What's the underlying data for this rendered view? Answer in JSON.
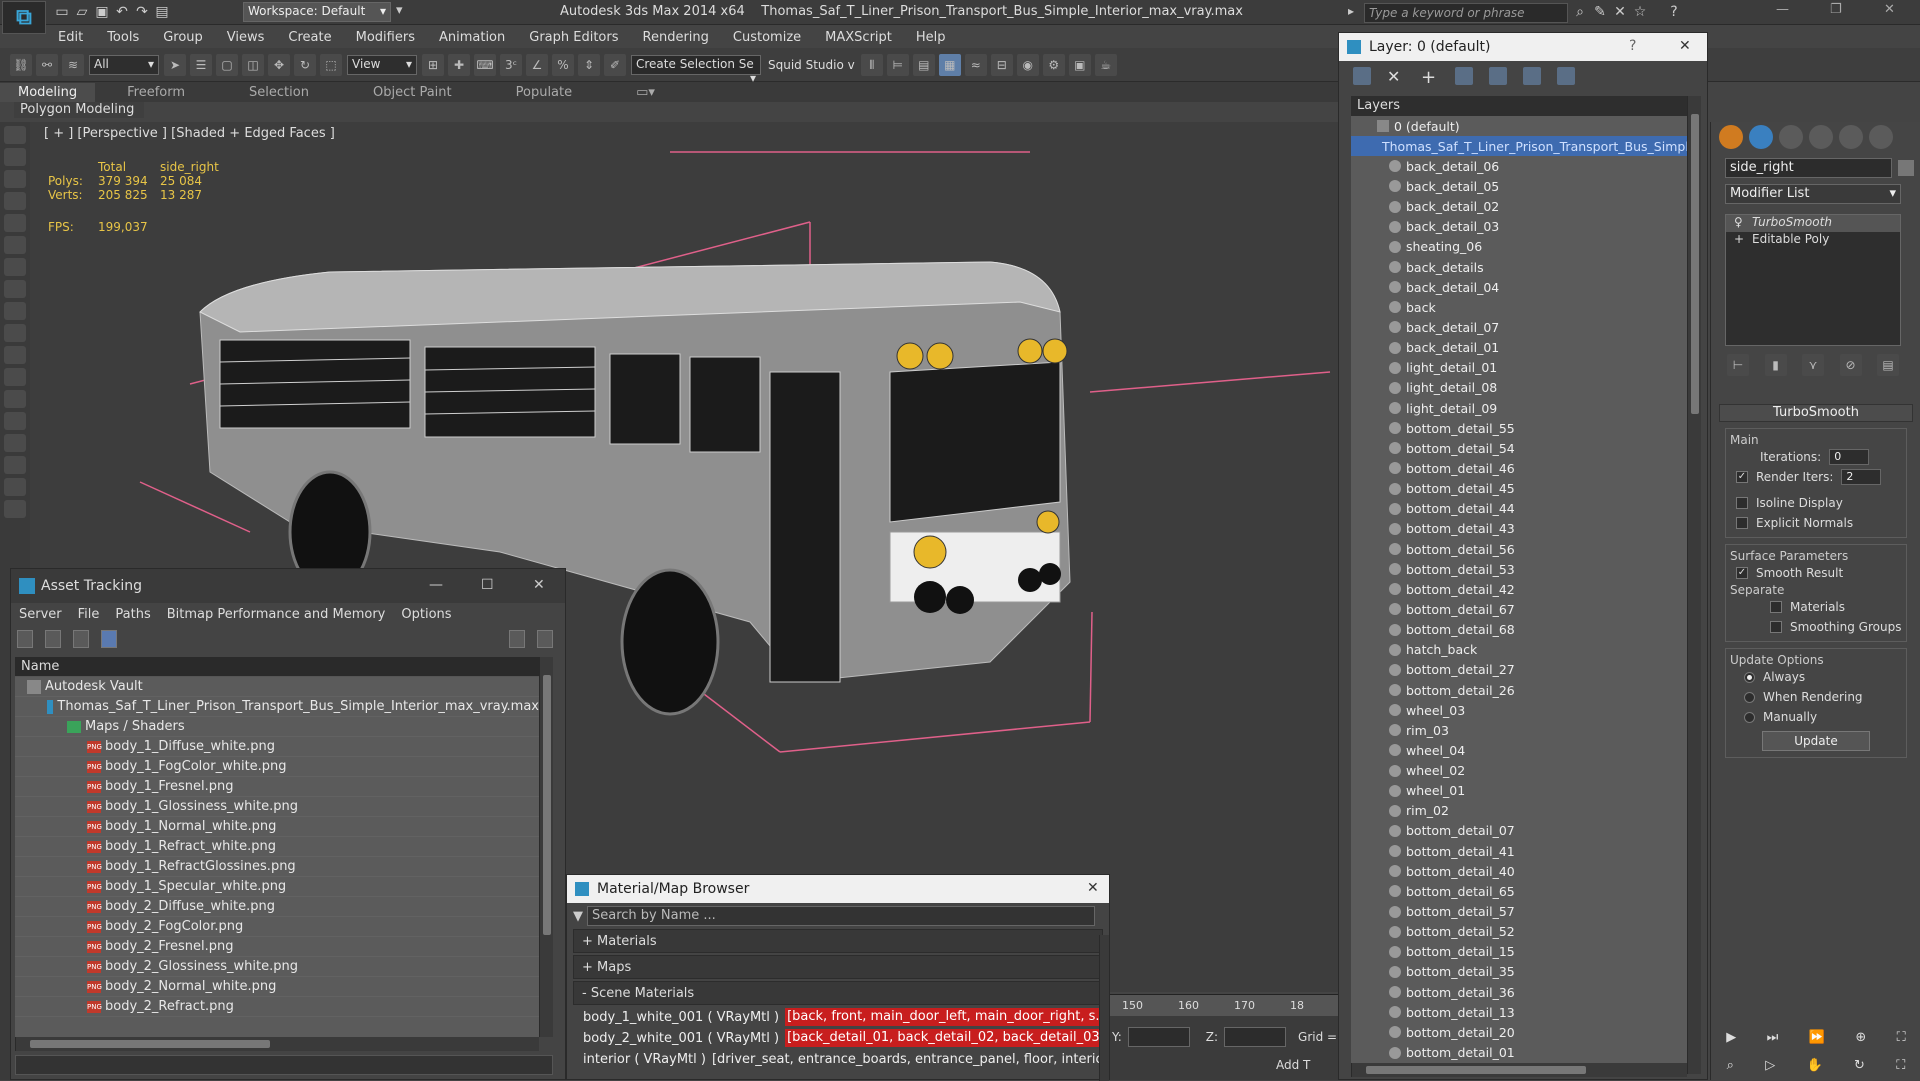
{
  "window": {
    "app_name": "Autodesk 3ds Max  2014 x64",
    "file_name": "Thomas_Saf_T_Liner_Prison_Transport_Bus_Simple_Interior_max_vray.max",
    "workspace": "Workspace: Default",
    "search_placeholder": "Type a keyword or phrase"
  },
  "menu": [
    "Edit",
    "Tools",
    "Group",
    "Views",
    "Create",
    "Modifiers",
    "Animation",
    "Graph Editors",
    "Rendering",
    "Customize",
    "MAXScript",
    "Help"
  ],
  "toolbar": {
    "filter": "All",
    "view": "View",
    "selection_set": "Create Selection Se",
    "squid": "Squid Studio v"
  },
  "ribbon": {
    "tabs": [
      "Modeling",
      "Freeform",
      "Selection",
      "Object Paint",
      "Populate"
    ],
    "panel": "Polygon Modeling"
  },
  "viewport": {
    "label": "[ + ] [Perspective ] [Shaded + Edged Faces ]",
    "stats": {
      "col_total": "Total",
      "col_sel": "side_right",
      "polys_label": "Polys:",
      "polys_total": "379 394",
      "polys_sel": "25 084",
      "verts_label": "Verts:",
      "verts_total": "205 825",
      "verts_sel": "13 287",
      "fps_label": "FPS:",
      "fps_value": "199,037"
    }
  },
  "asset_tracking": {
    "title": "Asset Tracking",
    "menu": [
      "Server",
      "File",
      "Paths",
      "Bitmap Performance and Memory",
      "Options"
    ],
    "column": "Name",
    "rows": [
      {
        "label": "Autodesk Vault",
        "level": 0,
        "type": "vault"
      },
      {
        "label": "Thomas_Saf_T_Liner_Prison_Transport_Bus_Simple_Interior_max_vray.max",
        "level": 1,
        "type": "max"
      },
      {
        "label": "Maps / Shaders",
        "level": 2,
        "type": "folder"
      },
      {
        "label": "body_1_Diffuse_white.png",
        "level": 3,
        "type": "png"
      },
      {
        "label": "body_1_FogColor_white.png",
        "level": 3,
        "type": "png"
      },
      {
        "label": "body_1_Fresnel.png",
        "level": 3,
        "type": "png"
      },
      {
        "label": "body_1_Glossiness_white.png",
        "level": 3,
        "type": "png"
      },
      {
        "label": "body_1_Normal_white.png",
        "level": 3,
        "type": "png"
      },
      {
        "label": "body_1_Refract_white.png",
        "level": 3,
        "type": "png"
      },
      {
        "label": "body_1_RefractGlossines.png",
        "level": 3,
        "type": "png"
      },
      {
        "label": "body_1_Specular_white.png",
        "level": 3,
        "type": "png"
      },
      {
        "label": "body_2_Diffuse_white.png",
        "level": 3,
        "type": "png"
      },
      {
        "label": "body_2_FogColor.png",
        "level": 3,
        "type": "png"
      },
      {
        "label": "body_2_Fresnel.png",
        "level": 3,
        "type": "png"
      },
      {
        "label": "body_2_Glossiness_white.png",
        "level": 3,
        "type": "png"
      },
      {
        "label": "body_2_Normal_white.png",
        "level": 3,
        "type": "png"
      },
      {
        "label": "body_2_Refract.png",
        "level": 3,
        "type": "png"
      }
    ]
  },
  "material_browser": {
    "title": "Material/Map Browser",
    "search_placeholder": "Search by Name ...",
    "sections": [
      "+ Materials",
      "+ Maps",
      "- Scene Materials"
    ],
    "scene_materials": [
      {
        "name": "body_1_white_001  ( VRayMtl )",
        "objects": "[back, front, main_door_left, main_door_right, s..."
      },
      {
        "name": "body_2_white_001  ( VRayMtl )",
        "objects": "[back_detail_01, back_detail_02, back_detail_03..."
      },
      {
        "name": "interior  ( VRayMtl )",
        "objects": "[driver_seat, entrance_boards, entrance_panel, floor, interio..."
      }
    ]
  },
  "layer_window": {
    "title": "Layer: 0 (default)",
    "header": "Layers",
    "default_layer": "0 (default)",
    "selected_layer": "Thomas_Saf_T_Liner_Prison_Transport_Bus_Simple_I",
    "objects": [
      "back_detail_06",
      "back_detail_05",
      "back_detail_02",
      "back_detail_03",
      "sheating_06",
      "back_details",
      "back_detail_04",
      "back",
      "back_detail_07",
      "back_detail_01",
      "light_detail_01",
      "light_detail_08",
      "light_detail_09",
      "bottom_detail_55",
      "bottom_detail_54",
      "bottom_detail_46",
      "bottom_detail_45",
      "bottom_detail_44",
      "bottom_detail_43",
      "bottom_detail_56",
      "bottom_detail_53",
      "bottom_detail_42",
      "bottom_detail_67",
      "bottom_detail_68",
      "hatch_back",
      "bottom_detail_27",
      "bottom_detail_26",
      "wheel_03",
      "rim_03",
      "wheel_04",
      "wheel_02",
      "wheel_01",
      "rim_02",
      "bottom_detail_07",
      "bottom_detail_41",
      "bottom_detail_40",
      "bottom_detail_65",
      "bottom_detail_57",
      "bottom_detail_52",
      "bottom_detail_15",
      "bottom_detail_35",
      "bottom_detail_36",
      "bottom_detail_13",
      "bottom_detail_20",
      "bottom_detail_01"
    ]
  },
  "command_panel": {
    "object_name": "side_right",
    "modifier_list": "Modifier List",
    "stack": [
      "TurboSmooth",
      "Editable Poly"
    ],
    "rollout": "TurboSmooth",
    "main_group": "Main",
    "iterations_label": "Iterations:",
    "iterations": "0",
    "render_iters_label": "Render Iters:",
    "render_iters": "2",
    "isoline": "Isoline Display",
    "explicit_normals": "Explicit Normals",
    "surface_params": "Surface Parameters",
    "smooth_result": "Smooth Result",
    "separate": "Separate",
    "materials": "Materials",
    "smoothing_groups": "Smoothing Groups",
    "update_options": "Update Options",
    "always": "Always",
    "when_rendering": "When Rendering",
    "manually": "Manually",
    "update_button": "Update"
  },
  "timeline": {
    "ticks": [
      "150",
      "160",
      "170",
      "18"
    ],
    "y_label": "Y:",
    "z_label": "Z:",
    "grid_label": "Grid =",
    "add_time": "Add T"
  }
}
